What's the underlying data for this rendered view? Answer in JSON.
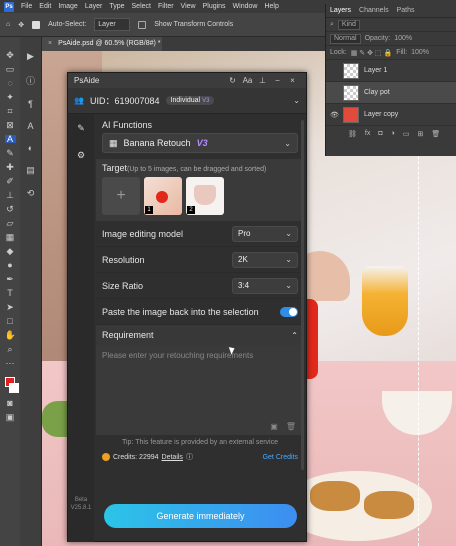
{
  "menubar": {
    "logo": "Ps",
    "items": [
      "File",
      "Edit",
      "Image",
      "Layer",
      "Type",
      "Select",
      "Filter",
      "View",
      "Plugins",
      "Window",
      "Help"
    ]
  },
  "options": {
    "auto_select_label": "Auto-Select:",
    "auto_select_value": "Layer",
    "show_transform_label": "Show Transform Controls"
  },
  "document": {
    "tab_title": "PsAide.psd @ 60.5% (RGB/8#) *"
  },
  "layers_panel": {
    "tabs": [
      "Layers",
      "Channels",
      "Paths"
    ],
    "filter_kind": "Kind",
    "blend_mode": "Normal",
    "opacity_label": "Opacity:",
    "opacity_value": "100%",
    "lock_label": "Lock:",
    "fill_label": "Fill:",
    "fill_value": "100%",
    "layers": [
      {
        "name": "Layer 1"
      },
      {
        "name": "Clay pot"
      },
      {
        "name": "Layer copy"
      }
    ]
  },
  "plugin": {
    "title": "PsAide",
    "uid": "UID：619007084",
    "tier": "Individual",
    "tier_badge": "V3",
    "ai_functions_label": "AI Functions",
    "function_value": "Banana Retouch",
    "function_version": "V3",
    "target_label": "Target",
    "target_hint": "(Up to 5 images, can be dragged and sorted)",
    "target_thumbs": [
      "1",
      "2"
    ],
    "model_label": "Image editing model",
    "model_value": "Pro",
    "resolution_label": "Resolution",
    "resolution_value": "2K",
    "size_ratio_label": "Size Ratio",
    "size_ratio_value": "3:4",
    "paste_back_label": "Paste the image back into the selection",
    "paste_back_on": true,
    "requirement_label": "Requirement",
    "requirement_placeholder": "Please enter your retouching requirements",
    "tip": "Tip: This feature is provided by an external service",
    "credits_label": "Credits: 22994",
    "details_label": "Details",
    "get_credits_label": "Get Credits",
    "generate_label": "Generate immediately",
    "beta_label": "Beta",
    "version_label": "V25.8.1"
  },
  "colors": {
    "accent_blue": "#2e8ee8",
    "v3_purple": "#b48cff",
    "generate_gradient_start": "#2cc4e8",
    "generate_gradient_end": "#3d8df0",
    "foreground": "#e02020"
  }
}
